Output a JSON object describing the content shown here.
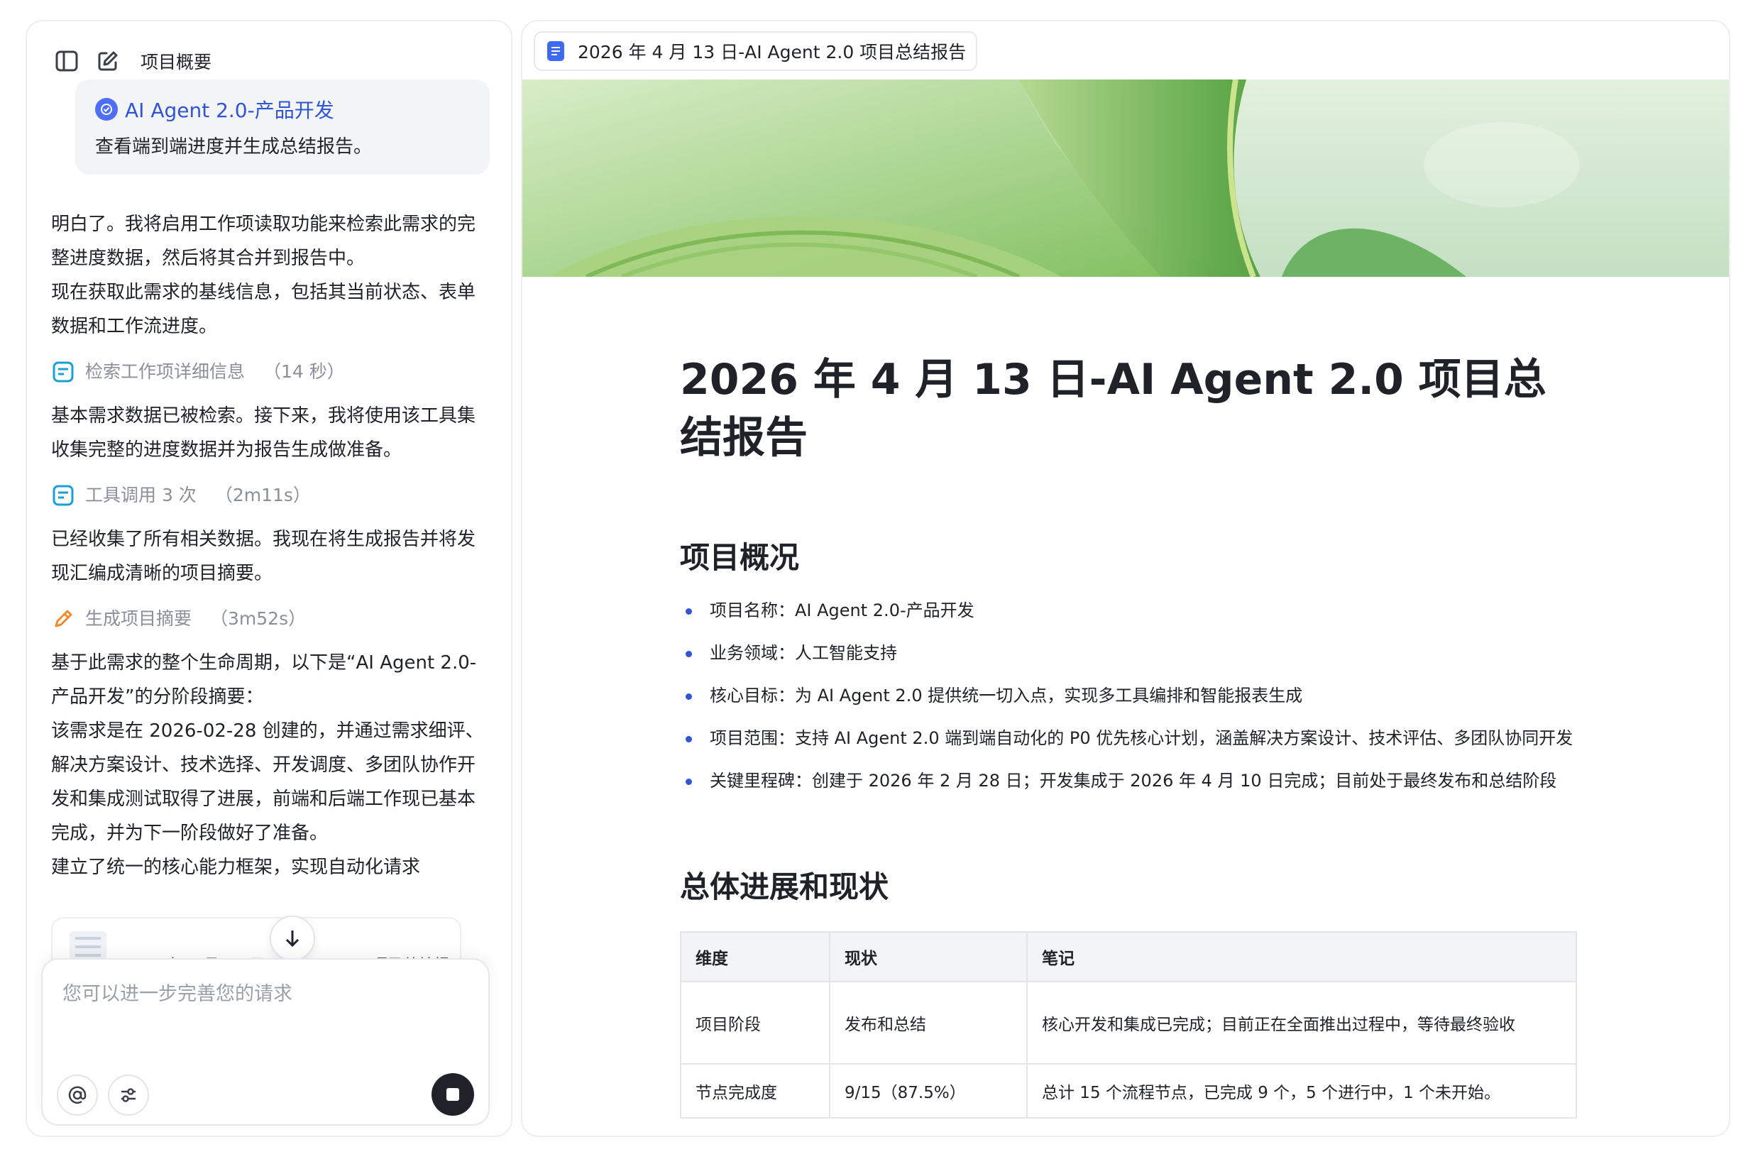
{
  "chat": {
    "header_title": "项目概要",
    "user_card": {
      "tag": "AI Agent 2.0-产品开发",
      "message": "查看端到端进度并生成总结报告。"
    },
    "messages": {
      "m1": "明白了。我将启用工作项读取功能来检索此需求的完整进度数据，然后将其合并到报告中。",
      "m2": "现在获取此需求的基线信息，包括其当前状态、表单数据和工作流进度。",
      "s1_label": "检索工作项详细信息",
      "s1_dur": "（14 秒）",
      "m3": "基本需求数据已被检索。接下来，我将使用该工具集收集完整的进度数据并为报告生成做准备。",
      "s2_label": "工具调用 3 次",
      "s2_dur": "（2m11s）",
      "m4": "已经收集了所有相关数据。我现在将生成报告并将发现汇编成清晰的项目摘要。",
      "s3_label": "生成项目摘要",
      "s3_dur": "（3m52s）",
      "m5": "基于此需求的整个生命周期，以下是“AI Agent 2.0-产品开发”的分阶段摘要：",
      "m6": "该需求是在 2026-02-28 创建的，并通过需求细评、解决方案设计、技术选择、开发调度、多团队协作开发和集成测试取得了进展，前端和后端工作现已基本完成，并为下一阶段做好了准备。",
      "m7": "建立了统一的核心能力框架，实现自动化请求"
    },
    "file_card_name": "2026 年 4 月 13 日-AI Agent 2.0 项目总结报告",
    "composer_placeholder": "您可以进一步完善您的请求"
  },
  "doc": {
    "tab_title": "2026 年 4 月 13 日-AI Agent 2.0 项目总结报告",
    "title": "2026 年 4 月 13 日-AI Agent 2.0 项目总结报告",
    "section1": "项目概况",
    "bullets": [
      "项目名称：AI Agent 2.0-产品开发",
      "业务领域：人工智能支持",
      "核心目标：为 AI Agent 2.0 提供统一切入点，实现多工具编排和智能报表生成",
      "项目范围：支持 AI Agent 2.0 端到端自动化的 P0 优先核心计划，涵盖解决方案设计、技术评估、多团队协同开发",
      "关键里程碑：创建于 2026 年 2 月 28 日；开发集成于 2026 年 4 月 10 日完成；目前处于最终发布和总结阶段"
    ],
    "section2": "总体进展和现状",
    "table": {
      "headers": [
        "维度",
        "现状",
        "笔记"
      ],
      "rows": [
        [
          "项目阶段",
          "发布和总结",
          "核心开发和集成已完成；目前正在全面推出过程中，等待最终验收"
        ],
        [
          "节点完成度",
          "9/15（87.5%）",
          "总计 15 个流程节点，已完成 9 个，5 个进行中，1 个未开始。"
        ]
      ]
    }
  },
  "colors": {
    "accent": "#2f54d6",
    "step_icon_blue": "#1a9fd6",
    "step_icon_orange": "#f08c2e"
  }
}
